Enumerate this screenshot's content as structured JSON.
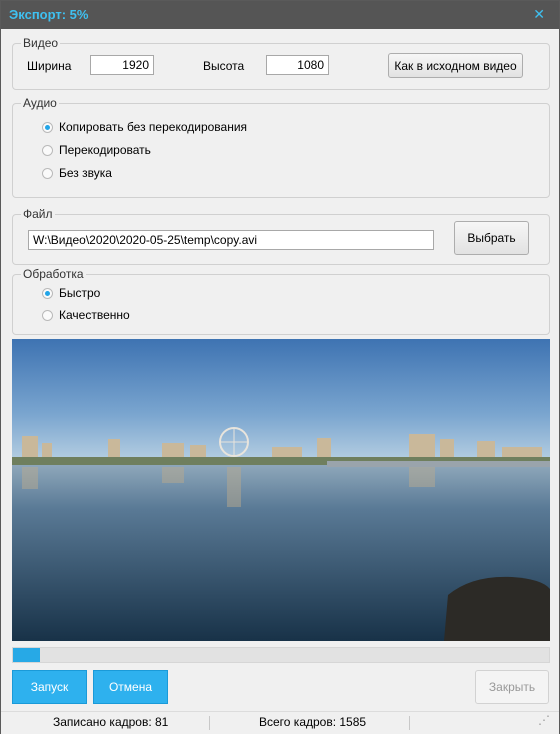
{
  "window": {
    "title": "Экспорт: 5%",
    "close_icon": "close-icon"
  },
  "video": {
    "legend": "Видео",
    "width_label": "Ширина",
    "width_value": "1920",
    "height_label": "Высота",
    "height_value": "1080",
    "same_as_source_button": "Как в исходном видео"
  },
  "audio": {
    "legend": "Аудио",
    "options": [
      "Копировать без перекодирования",
      "Перекодировать",
      "Без звука"
    ],
    "selected": "Копировать без перекодирования"
  },
  "file": {
    "legend": "Файл",
    "path": "W:\\Видео\\2020\\2020-05-25\\temp\\copy.avi",
    "browse_button": "Выбрать"
  },
  "processing": {
    "legend": "Обработка",
    "options": [
      "Быстро",
      "Качественно"
    ],
    "selected": "Быстро"
  },
  "progress": {
    "percent": 5
  },
  "buttons": {
    "start": "Запуск",
    "cancel": "Отмена",
    "close": "Закрыть"
  },
  "status": {
    "frames_written": "Записано кадров: 81",
    "frames_total": "Всего кадров: 1585"
  },
  "colors": {
    "accent": "#2eb1ee",
    "titlebar": "#555555",
    "title_text": "#3fc0f0"
  }
}
